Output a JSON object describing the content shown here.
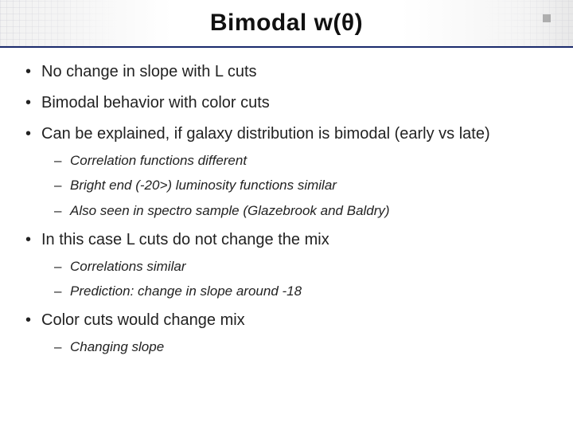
{
  "title": "Bimodal w(θ)",
  "bullets": [
    {
      "text": "No change in slope with L cuts",
      "sub": []
    },
    {
      "text": "Bimodal behavior with color cuts",
      "sub": []
    },
    {
      "text": "Can be explained, if galaxy distribution is bimodal (early vs late)",
      "sub": [
        "Correlation functions different",
        "Bright end (-20>) luminosity functions similar",
        "Also seen in spectro sample (Glazebrook and Baldry)"
      ]
    },
    {
      "text": "In this case L cuts do not change the mix",
      "sub": [
        "Correlations similar",
        "Prediction: change in slope around -18"
      ]
    },
    {
      "text": "Color cuts would change mix",
      "sub": [
        "Changing slope"
      ]
    }
  ]
}
